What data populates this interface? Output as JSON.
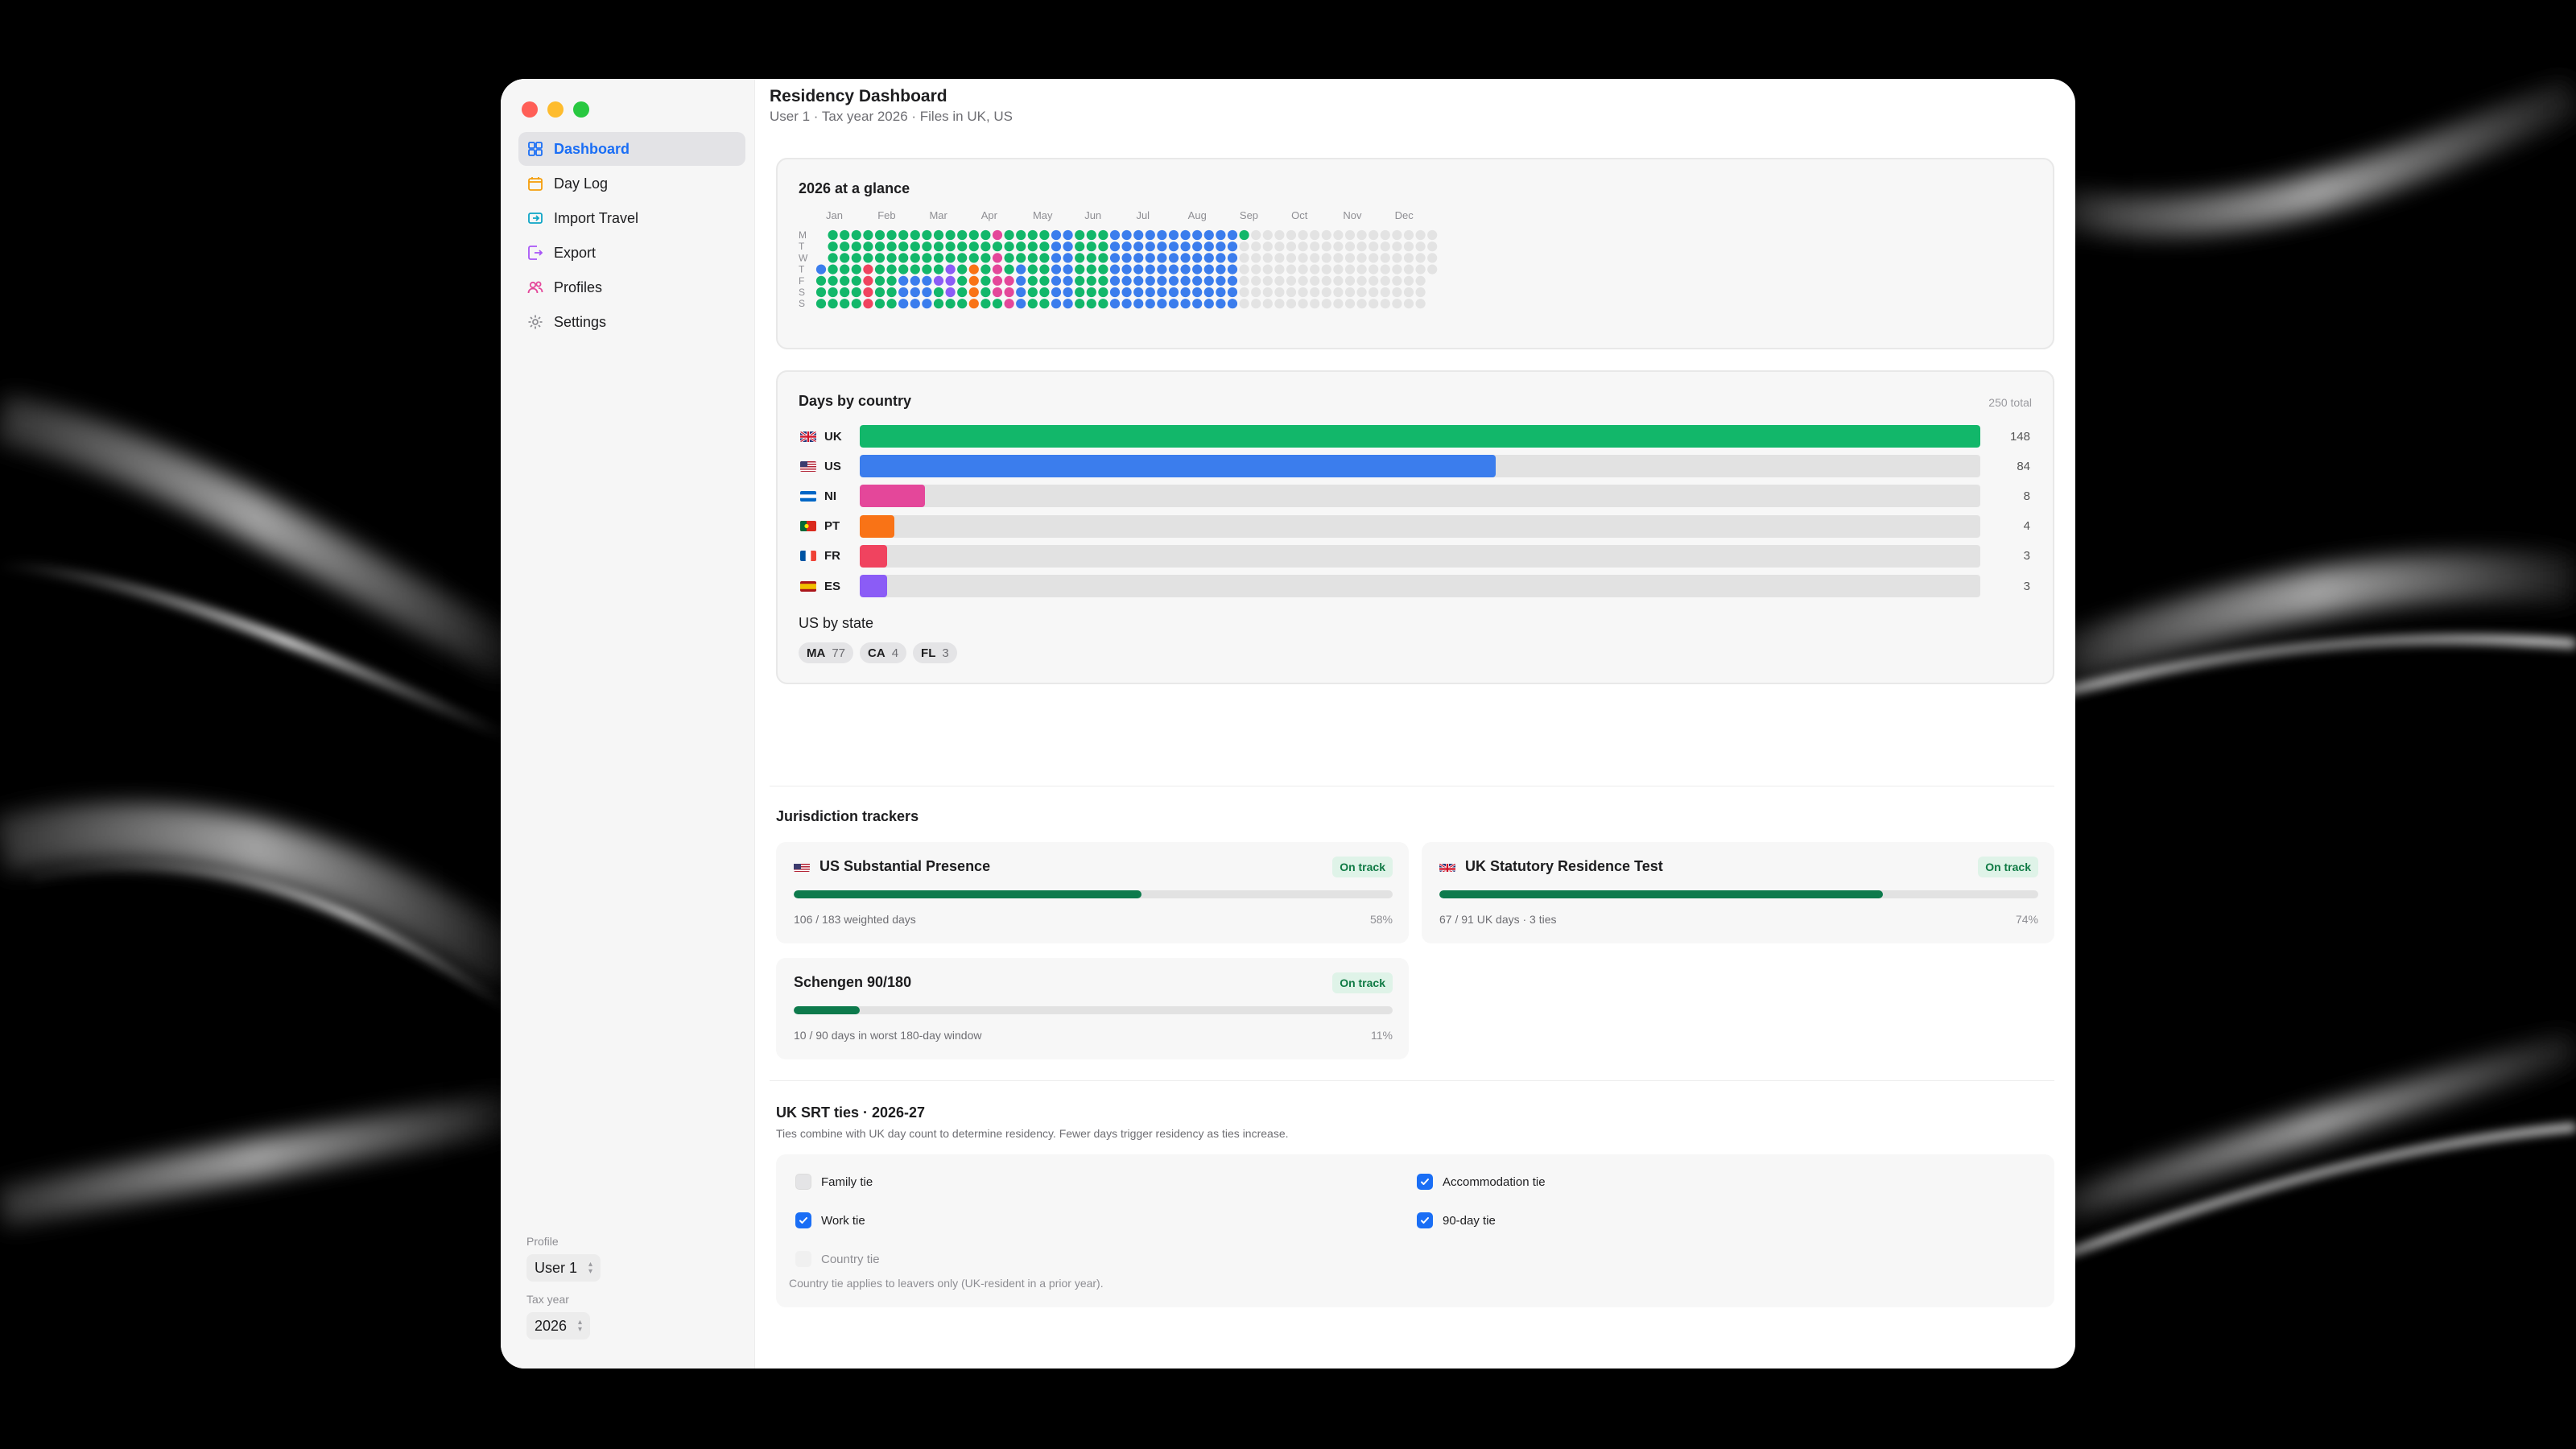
{
  "window": {
    "title": "Residency Dashboard",
    "subtitle": "User 1 · Tax year 2026 · Files in UK, US"
  },
  "sidebar": {
    "items": [
      {
        "label": "Dashboard",
        "icon": "dashboard-grid-icon",
        "active": true
      },
      {
        "label": "Day Log",
        "icon": "calendar-icon"
      },
      {
        "label": "Import Travel",
        "icon": "import-icon"
      },
      {
        "label": "Export",
        "icon": "export-icon"
      },
      {
        "label": "Profiles",
        "icon": "people-icon"
      },
      {
        "label": "Settings",
        "icon": "gear-icon"
      }
    ],
    "profile_label": "Profile",
    "profile_value": "User 1",
    "taxyear_label": "Tax year",
    "taxyear_value": "2026"
  },
  "glance": {
    "title": "2026 at a glance",
    "months": [
      "Jan",
      "Feb",
      "Mar",
      "Apr",
      "May",
      "Jun",
      "Jul",
      "Aug",
      "Sep",
      "Oct",
      "Nov",
      "Dec"
    ],
    "weekdays": [
      "M",
      "T",
      "W",
      "T",
      "F",
      "S",
      "S"
    ],
    "colors": {
      "UK": "#12b76a",
      "US": "#3b7ded",
      "NI": "#e4479a",
      "PT": "#f97316",
      "FR": "#f0435f",
      "ES": "#8b5cf6",
      "empty": "#e3e3e3"
    }
  },
  "days_by_country": {
    "title": "Days by country",
    "total_label": "250 total",
    "max": 148,
    "rows": [
      {
        "code": "UK",
        "value": 148,
        "display": "148",
        "color": "#12b76a",
        "flag": "uk-flag-icon"
      },
      {
        "code": "US",
        "value": 84,
        "display": "84",
        "color": "#3b7ded",
        "flag": "us-flag-icon"
      },
      {
        "code": "NI",
        "value": 8,
        "display": "8",
        "color": "#e4479a",
        "flag": "ni-flag-icon"
      },
      {
        "code": "PT",
        "value": 4,
        "display": "4",
        "color": "#f97316",
        "flag": "pt-flag-icon"
      },
      {
        "code": "FR",
        "value": 3,
        "display": "3",
        "color": "#f0435f",
        "flag": "fr-flag-icon"
      },
      {
        "code": "ES",
        "value": 3,
        "display": "3",
        "color": "#8b5cf6",
        "flag": "es-flag-icon"
      }
    ],
    "us_by_state_title": "US by state",
    "states": [
      {
        "code": "MA",
        "value": "77"
      },
      {
        "code": "CA",
        "value": "4"
      },
      {
        "code": "FL",
        "value": "3"
      }
    ]
  },
  "trackers": {
    "title": "Jurisdiction trackers",
    "items": [
      {
        "name": "US Substantial Presence",
        "status": "On track",
        "detail": "106 / 183 weighted days",
        "pct_label": "58%",
        "fraction": 0.58,
        "flag": "us-flag-icon"
      },
      {
        "name": "UK Statutory Residence Test",
        "status": "On track",
        "detail": "67 / 91 UK days · 3 ties",
        "pct_label": "74%",
        "fraction": 0.74,
        "flag": "uk-flag-icon"
      },
      {
        "name": "Schengen 90/180",
        "status": "On track",
        "detail": "10 / 90 days in worst 180-day window",
        "pct_label": "11%",
        "fraction": 0.11,
        "flag": ""
      }
    ]
  },
  "ties": {
    "title": "UK SRT ties · 2026-27",
    "description": "Ties combine with UK day count to determine residency. Fewer days trigger residency as ties increase.",
    "items": [
      {
        "label": "Family tie",
        "checked": false
      },
      {
        "label": "Accommodation tie",
        "checked": true
      },
      {
        "label": "Work tie",
        "checked": true
      },
      {
        "label": "90-day tie",
        "checked": true
      },
      {
        "label": "Country tie",
        "checked": false,
        "disabled": true
      }
    ],
    "note": "Country tie applies to leavers only (UK-resident in a prior year)."
  }
}
